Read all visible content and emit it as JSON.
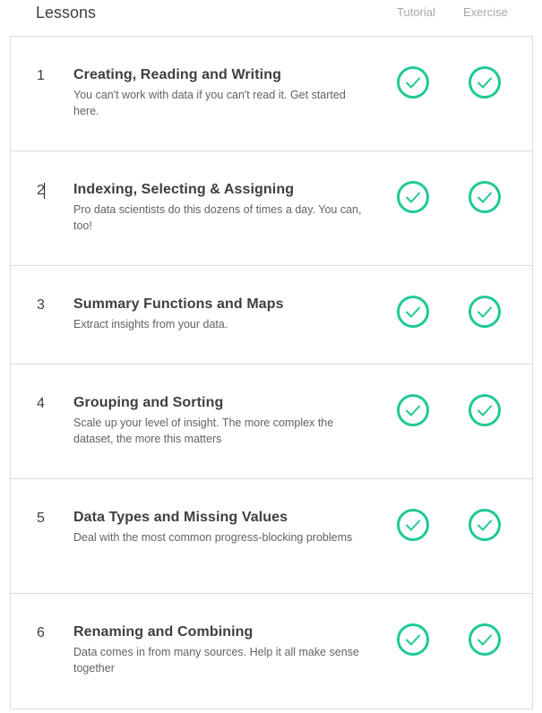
{
  "header": {
    "title": "Lessons",
    "col_tutorial": "Tutorial",
    "col_exercise": "Exercise"
  },
  "colors": {
    "check_green": "#20c997",
    "border": "#dadce0",
    "muted": "#a5a8ad"
  },
  "lessons": [
    {
      "num": "1",
      "title": "Creating, Reading and Writing",
      "desc": "You can't work with data if you can't read it. Get started here.",
      "tutorial_done": true,
      "exercise_done": true
    },
    {
      "num": "2",
      "title": "Indexing, Selecting & Assigning",
      "desc": "Pro data scientists do this dozens of times a day. You can, too!",
      "tutorial_done": true,
      "exercise_done": true
    },
    {
      "num": "3",
      "title": "Summary Functions and Maps",
      "desc": "Extract insights from your data.",
      "tutorial_done": true,
      "exercise_done": true
    },
    {
      "num": "4",
      "title": "Grouping and Sorting",
      "desc": "Scale up your level of insight. The more complex the dataset, the more this matters",
      "tutorial_done": true,
      "exercise_done": true
    },
    {
      "num": "5",
      "title": "Data Types and Missing Values",
      "desc": "Deal with the most common progress-blocking problems",
      "tutorial_done": true,
      "exercise_done": true
    },
    {
      "num": "6",
      "title": "Renaming and Combining",
      "desc": "Data comes in from many sources. Help it all make sense together",
      "tutorial_done": true,
      "exercise_done": true
    }
  ]
}
